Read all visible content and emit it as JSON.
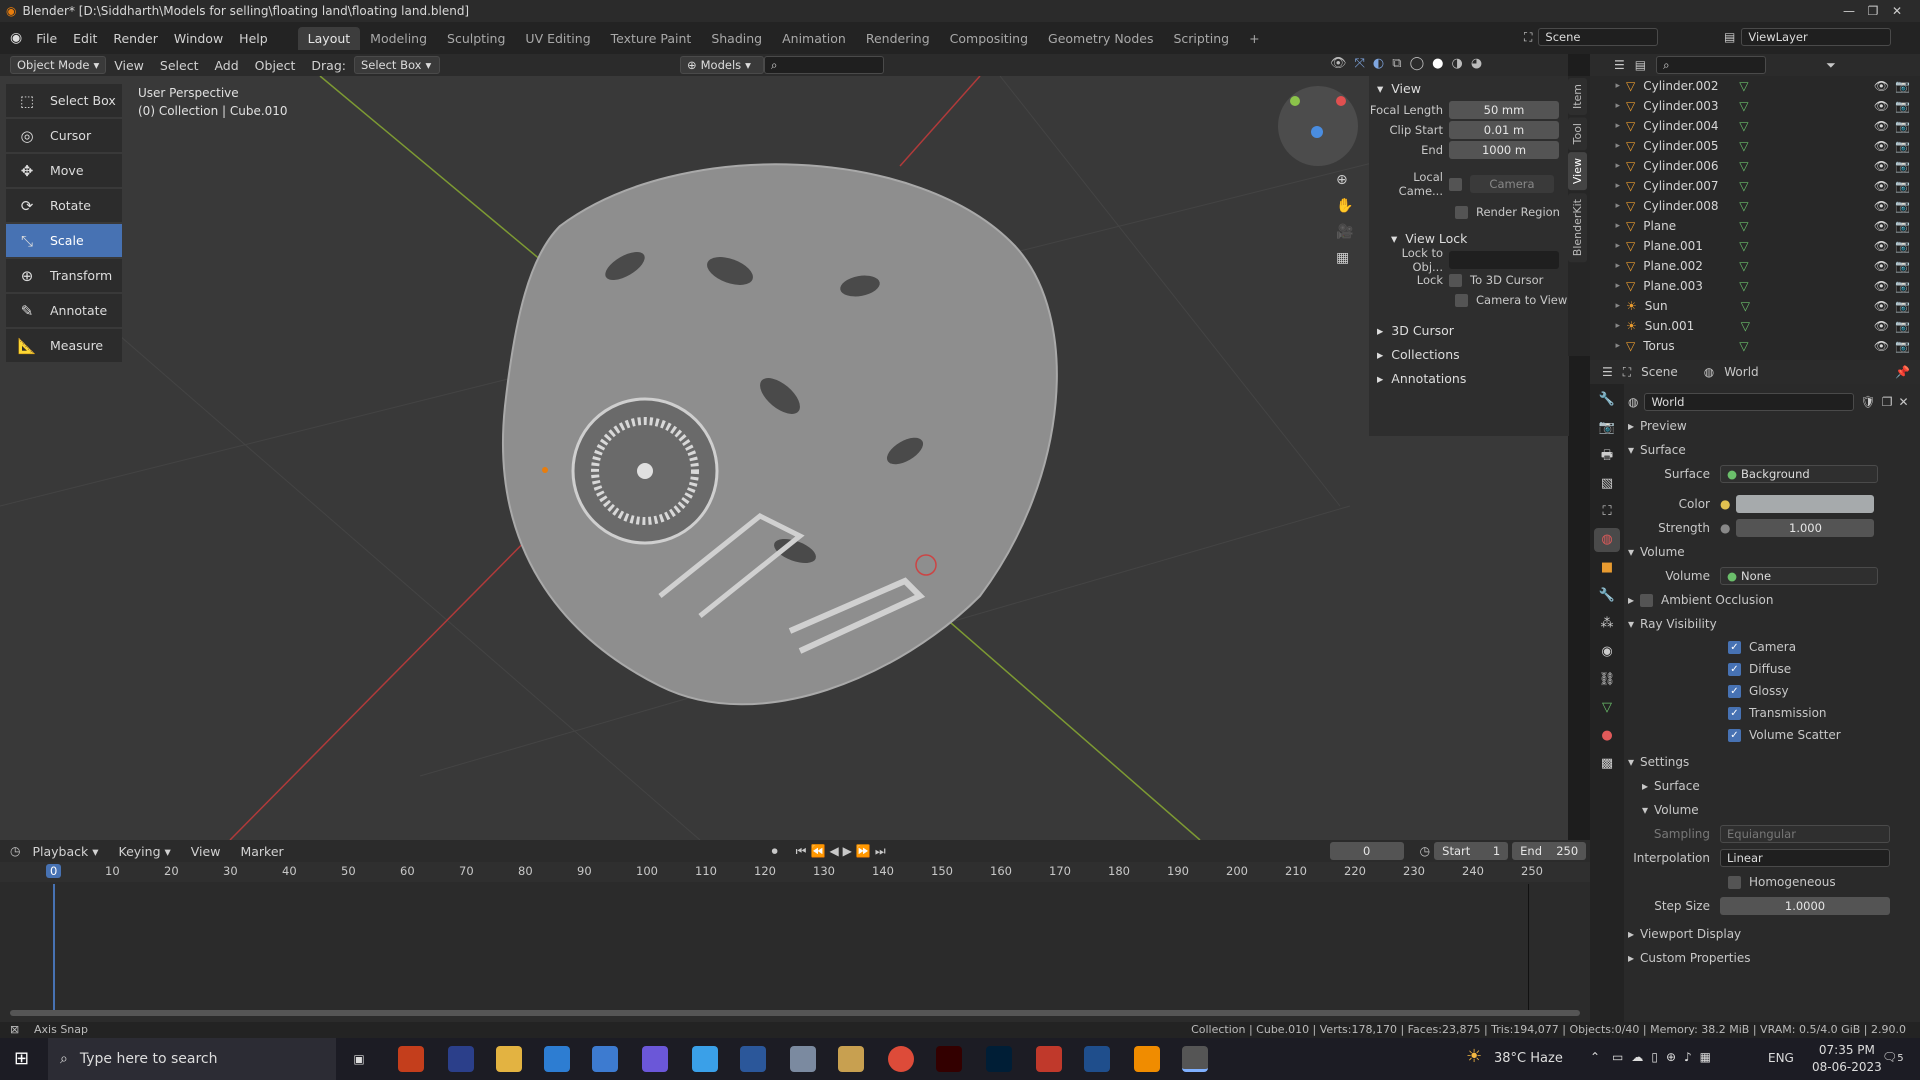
{
  "titlebar": {
    "title": "Blender* [D:\\Siddharth\\Models for selling\\floating land\\floating land.blend]"
  },
  "menus": [
    "File",
    "Edit",
    "Render",
    "Window",
    "Help"
  ],
  "workspaces": [
    "Layout",
    "Modeling",
    "Sculpting",
    "UV Editing",
    "Texture Paint",
    "Shading",
    "Animation",
    "Rendering",
    "Compositing",
    "Geometry Nodes",
    "Scripting"
  ],
  "scene": {
    "name": "Scene",
    "viewlayer": "ViewLayer"
  },
  "header": {
    "mode": "Object Mode",
    "view": "View",
    "select": "Select",
    "add": "Add",
    "object": "Object",
    "drag_label": "Drag:",
    "drag_value": "Select Box",
    "models": "Models"
  },
  "viewport": {
    "perspective": "User Perspective",
    "collection": "(0) Collection | Cube.010"
  },
  "tools": [
    {
      "label": "Select Box",
      "icon": "⬚"
    },
    {
      "label": "Cursor",
      "icon": "◎"
    },
    {
      "label": "Move",
      "icon": "✥"
    },
    {
      "label": "Rotate",
      "icon": "⟳"
    },
    {
      "label": "Scale",
      "icon": "⤡"
    },
    {
      "label": "Transform",
      "icon": "⊕"
    },
    {
      "label": "Annotate",
      "icon": "✎"
    },
    {
      "label": "Measure",
      "icon": "📐"
    }
  ],
  "npanel": {
    "title": "View",
    "focal_label": "Focal Length",
    "focal": "50 mm",
    "clipstart_label": "Clip Start",
    "clipstart": "0.01 m",
    "end_label": "End",
    "end": "1000 m",
    "localcam_label": "Local Came...",
    "camera": "Camera",
    "render_region": "Render Region",
    "viewlock": "View Lock",
    "lockobj_label": "Lock to Obj...",
    "lock_label": "Lock",
    "to3d": "To 3D Cursor",
    "camview": "Camera to View",
    "cursor3d": "3D Cursor",
    "collections": "Collections",
    "annotations": "Annotations"
  },
  "vtabs": [
    "Item",
    "Tool",
    "View",
    "BlenderKit"
  ],
  "outliner": [
    "Cylinder.002",
    "Cylinder.003",
    "Cylinder.004",
    "Cylinder.005",
    "Cylinder.006",
    "Cylinder.007",
    "Cylinder.008",
    "Plane",
    "Plane.001",
    "Plane.002",
    "Plane.003",
    "Sun",
    "Sun.001",
    "Torus"
  ],
  "props": {
    "scene_tab": "Scene",
    "world_tab": "World",
    "world_name": "World",
    "preview": "Preview",
    "surface": "Surface",
    "surface_label": "Surface",
    "surface_val": "Background",
    "color_label": "Color",
    "strength_label": "Strength",
    "strength": "1.000",
    "volume": "Volume",
    "volume_label": "Volume",
    "volume_val": "None",
    "ao": "Ambient Occlusion",
    "ray": "Ray Visibility",
    "camera": "Camera",
    "diffuse": "Diffuse",
    "glossy": "Glossy",
    "transmission": "Transmission",
    "volscatter": "Volume Scatter",
    "settings": "Settings",
    "s_surface": "Surface",
    "s_volume": "Volume",
    "sampling_label": "Sampling",
    "sampling": "Equiangular",
    "interp_label": "Interpolation",
    "interp": "Linear",
    "homogeneous": "Homogeneous",
    "stepsize_label": "Step Size",
    "stepsize": "1.0000",
    "viewport_display": "Viewport Display",
    "custom_props": "Custom Properties"
  },
  "timeline": {
    "playback": "Playback",
    "keying": "Keying",
    "view": "View",
    "marker": "Marker",
    "frame": "0",
    "start_label": "Start",
    "start": "1",
    "end_label": "End",
    "end": "250",
    "ticks": [
      "0",
      "10",
      "20",
      "30",
      "40",
      "50",
      "60",
      "70",
      "80",
      "90",
      "100",
      "110",
      "120",
      "130",
      "140",
      "150",
      "160",
      "170",
      "180",
      "190",
      "200",
      "210",
      "220",
      "230",
      "240",
      "250"
    ]
  },
  "status": {
    "left": "Axis Snap",
    "right": "Collection | Cube.010 | Verts:178,170 | Faces:23,875 | Tris:194,077 | Objects:0/40 | Memory: 38.2 MiB | VRAM: 0.5/4.0 GiB | 2.90.0"
  },
  "taskbar": {
    "search": "Type here to search",
    "weather": "38°C  Haze",
    "lang": "ENG",
    "time": "07:35 PM",
    "date": "08-06-2023",
    "notif": "5"
  },
  "colors": {
    "accent": "#4772b3",
    "world_color": "#a6aaac"
  }
}
